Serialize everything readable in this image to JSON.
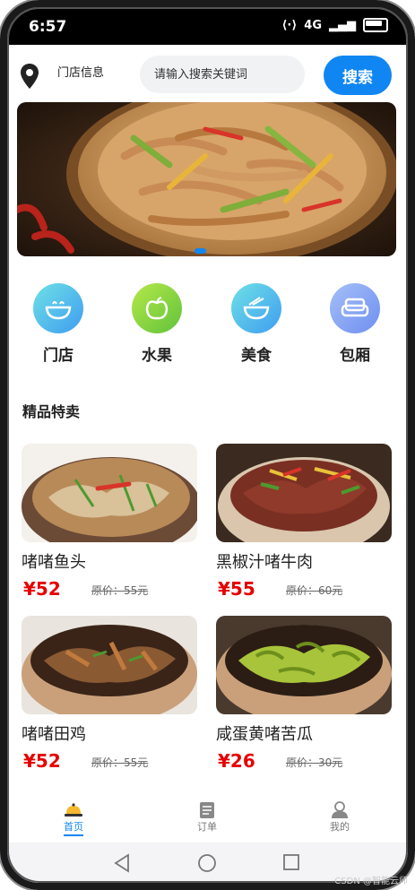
{
  "status": {
    "time": "6:57",
    "signal_label": "4G"
  },
  "header": {
    "store_info": "门店信息",
    "search_placeholder": "请输入搜索关键词",
    "search_button": "搜索"
  },
  "banner": {
    "image": "stir-fried shredded pork dish",
    "active_dot": 1
  },
  "categories": [
    {
      "label": "门店",
      "icon": "bowl-icon"
    },
    {
      "label": "水果",
      "icon": "apple-icon"
    },
    {
      "label": "美食",
      "icon": "food-bowl-icon"
    },
    {
      "label": "包厢",
      "icon": "sofa-icon"
    }
  ],
  "section_title": "精品特卖",
  "products": [
    {
      "name": "啫啫鱼头",
      "price": "¥52",
      "original": "原价：55元"
    },
    {
      "name": "黑椒汁啫牛肉",
      "price": "¥55",
      "original": "原价：60元"
    },
    {
      "name": "啫啫田鸡",
      "price": "¥52",
      "original": "原价：55元"
    },
    {
      "name": "咸蛋黄啫苦瓜",
      "price": "¥26",
      "original": "原价：30元"
    }
  ],
  "tabs": [
    {
      "label": "首页",
      "icon": "home-bell-icon",
      "active": true
    },
    {
      "label": "订单",
      "icon": "order-icon",
      "active": false
    },
    {
      "label": "我的",
      "icon": "profile-icon",
      "active": false
    }
  ],
  "watermark": "CSDN @智能云师",
  "colors": {
    "accent": "#1086f2",
    "price": "#e60000"
  }
}
